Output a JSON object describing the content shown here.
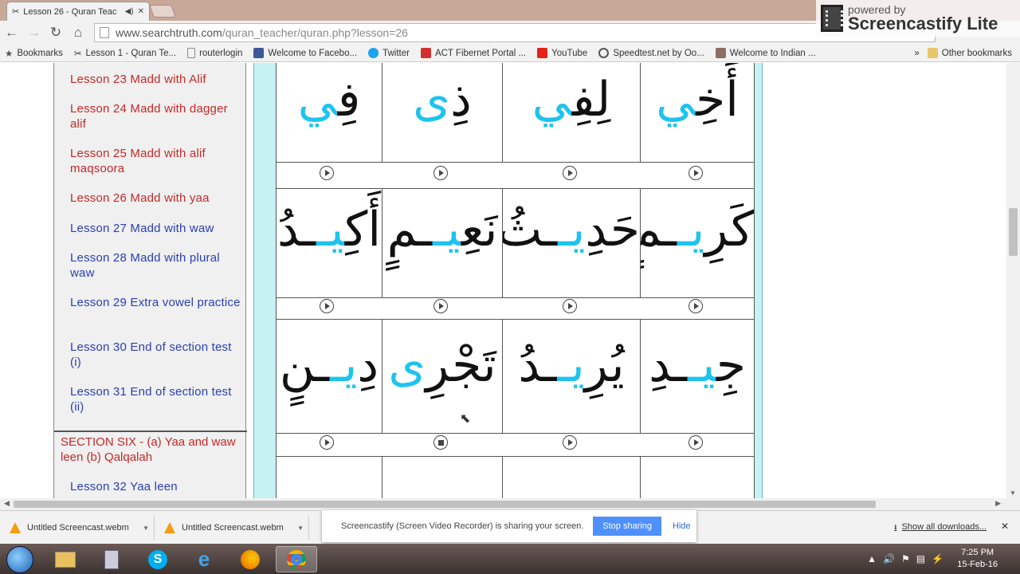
{
  "browser": {
    "tab_title": "Lesson 26 - Quran Teac",
    "url_host": "www.searchtruth.com",
    "url_path": "/quran_teacher/quran.php?lesson=26",
    "bookmarks": [
      "Bookmarks",
      "Lesson 1 - Quran Te...",
      "routerlogin",
      "Welcome to Facebo...",
      "Twitter",
      "ACT Fibernet Portal ...",
      "YouTube",
      "Speedtest.net by Oo...",
      "Welcome to Indian ..."
    ],
    "other_bookmarks": "Other bookmarks",
    "more": "»"
  },
  "screencastify_badge": {
    "powered_by": "powered by",
    "name": "Screencastify Lite"
  },
  "sidebar": {
    "lessons": [
      {
        "label": "Lesson 23 Madd with Alif",
        "color": "#c62828"
      },
      {
        "label": "Lesson 24 Madd with dagger alif",
        "color": "#c62828"
      },
      {
        "label": "Lesson 25 Madd with alif maqsoora",
        "color": "#c62828"
      },
      {
        "label": "Lesson 26 Madd with yaa",
        "color": "#c62828"
      },
      {
        "label": "Lesson 27 Madd with waw",
        "color": "#2a3fb5"
      },
      {
        "label": "Lesson 28 Madd with plural waw",
        "color": "#2a3fb5"
      },
      {
        "label": "Lesson 29 Extra vowel practice",
        "color": "#2a3fb5"
      },
      {
        "label": "Lesson 30 End of section test (i)",
        "color": "#2a3fb5"
      },
      {
        "label": "Lesson 31 End of section test (ii)",
        "color": "#2a3fb5"
      }
    ],
    "section_heading": "SECTION SIX - (a) Yaa and waw leen (b) Qalqalah",
    "next_lesson": "Lesson 32 Yaa leen"
  },
  "words": {
    "row1": [
      {
        "base": "أَخِ",
        "accent": "ي"
      },
      {
        "base": "لِفِ",
        "accent": "ي"
      },
      {
        "base": "ذِ",
        "accent": "ى"
      },
      {
        "base": "فِ",
        "accent": "ي"
      }
    ],
    "row2": [
      {
        "base": "كَرِ",
        "accent": "يـ",
        "tail": "ـمٍ"
      },
      {
        "base": "حَدِ",
        "accent": "يـ",
        "tail": "ـثُ"
      },
      {
        "base": "نَعِ",
        "accent": "يـ",
        "tail": "ـمٍ"
      },
      {
        "base": "أَكِ",
        "accent": "يـ",
        "tail": "ـدُ"
      }
    ],
    "row3": [
      {
        "base": "جِ",
        "accent": "يـ",
        "tail": "ـدِ"
      },
      {
        "base": "يُرِ",
        "accent": "يـ",
        "tail": "ـدُ"
      },
      {
        "base": "تَجْرِ",
        "accent": "ى"
      },
      {
        "base": "دِ",
        "accent": "يـ",
        "tail": "ـنٍ"
      }
    ]
  },
  "downloads": {
    "items": [
      "Untitled Screencast.webm",
      "Untitled Screencast.webm"
    ],
    "show_all": "Show all downloads..."
  },
  "share_bar": {
    "message": "Screencastify (Screen Video Recorder) is sharing your screen.",
    "stop_label": "Stop sharing",
    "hide_label": "Hide"
  },
  "taskbar": {
    "time": "7:25 PM",
    "date": "15-Feb-16"
  }
}
